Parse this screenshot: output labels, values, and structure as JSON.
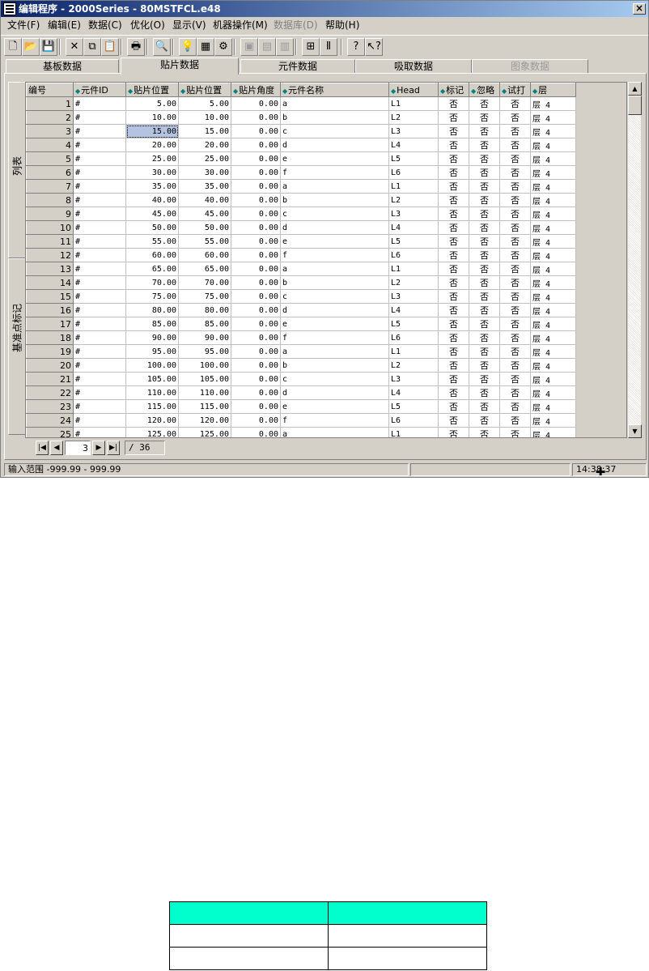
{
  "window": {
    "title": "编辑程序 - 2000Series - 80MSTFCL.e48",
    "close_label": "×"
  },
  "menu": [
    {
      "label": "文件(F)",
      "disabled": false
    },
    {
      "label": "编辑(E)",
      "disabled": false
    },
    {
      "label": "数据(C)",
      "disabled": false
    },
    {
      "label": "优化(O)",
      "disabled": false
    },
    {
      "label": "显示(V)",
      "disabled": false
    },
    {
      "label": "机器操作(M)",
      "disabled": false
    },
    {
      "label": "数据库(D)",
      "disabled": true
    },
    {
      "label": "帮助(H)",
      "disabled": false
    }
  ],
  "toolbar": {
    "buttons": [
      {
        "icon": "new-file-icon",
        "glyph": "🗋"
      },
      {
        "icon": "open-folder-icon",
        "glyph": "📂"
      },
      {
        "icon": "save-icon",
        "glyph": "💾"
      },
      {
        "icon": "cut-icon",
        "glyph": "✕"
      },
      {
        "icon": "copy-icon",
        "glyph": "⧉"
      },
      {
        "icon": "paste-icon",
        "glyph": "📋"
      },
      {
        "icon": "print-icon",
        "glyph": "🖶"
      },
      {
        "icon": "find-icon",
        "glyph": "🔍"
      },
      {
        "icon": "bulb-icon",
        "glyph": "💡"
      },
      {
        "icon": "component-icon",
        "glyph": "▦"
      },
      {
        "icon": "optimize-icon",
        "glyph": "⚙"
      },
      {
        "icon": "machine-icon",
        "glyph": "▣"
      },
      {
        "icon": "feeder-icon",
        "glyph": "▤"
      },
      {
        "icon": "box-icon",
        "glyph": "▥"
      },
      {
        "icon": "fit-icon",
        "glyph": "⊞"
      },
      {
        "icon": "align-icon",
        "glyph": "Ⅱ"
      },
      {
        "icon": "help-icon",
        "glyph": "?"
      },
      {
        "icon": "context-help-icon",
        "glyph": "↖?"
      }
    ]
  },
  "tabs": [
    {
      "label": "基板数据",
      "active": false,
      "disabled": false
    },
    {
      "label": "贴片数据",
      "active": true,
      "disabled": false
    },
    {
      "label": "元件数据",
      "active": false,
      "disabled": false
    },
    {
      "label": "吸取数据",
      "active": false,
      "disabled": false
    },
    {
      "label": "图象数据",
      "active": false,
      "disabled": true
    }
  ],
  "side_tabs": [
    {
      "label": "列表"
    },
    {
      "label": "基准点标记"
    }
  ],
  "grid": {
    "columns": [
      "编号",
      "元件ID",
      "贴片位置",
      "贴片位置",
      "贴片角度",
      "元件名称",
      "Head",
      "标记",
      "忽略",
      "试打",
      "层"
    ],
    "sortable": [
      false,
      true,
      true,
      true,
      true,
      true,
      true,
      true,
      true,
      true,
      true
    ],
    "rows": [
      [
        "1",
        "#",
        "5.00",
        "5.00",
        "0.00",
        "a",
        "L1",
        "否",
        "否",
        "否",
        "层 4"
      ],
      [
        "2",
        "#",
        "10.00",
        "10.00",
        "0.00",
        "b",
        "L2",
        "否",
        "否",
        "否",
        "层 4"
      ],
      [
        "3",
        "#",
        "15.00",
        "15.00",
        "0.00",
        "c",
        "L3",
        "否",
        "否",
        "否",
        "层 4"
      ],
      [
        "4",
        "#",
        "20.00",
        "20.00",
        "0.00",
        "d",
        "L4",
        "否",
        "否",
        "否",
        "层 4"
      ],
      [
        "5",
        "#",
        "25.00",
        "25.00",
        "0.00",
        "e",
        "L5",
        "否",
        "否",
        "否",
        "层 4"
      ],
      [
        "6",
        "#",
        "30.00",
        "30.00",
        "0.00",
        "f",
        "L6",
        "否",
        "否",
        "否",
        "层 4"
      ],
      [
        "7",
        "#",
        "35.00",
        "35.00",
        "0.00",
        "a",
        "L1",
        "否",
        "否",
        "否",
        "层 4"
      ],
      [
        "8",
        "#",
        "40.00",
        "40.00",
        "0.00",
        "b",
        "L2",
        "否",
        "否",
        "否",
        "层 4"
      ],
      [
        "9",
        "#",
        "45.00",
        "45.00",
        "0.00",
        "c",
        "L3",
        "否",
        "否",
        "否",
        "层 4"
      ],
      [
        "10",
        "#",
        "50.00",
        "50.00",
        "0.00",
        "d",
        "L4",
        "否",
        "否",
        "否",
        "层 4"
      ],
      [
        "11",
        "#",
        "55.00",
        "55.00",
        "0.00",
        "e",
        "L5",
        "否",
        "否",
        "否",
        "层 4"
      ],
      [
        "12",
        "#",
        "60.00",
        "60.00",
        "0.00",
        "f",
        "L6",
        "否",
        "否",
        "否",
        "层 4"
      ],
      [
        "13",
        "#",
        "65.00",
        "65.00",
        "0.00",
        "a",
        "L1",
        "否",
        "否",
        "否",
        "层 4"
      ],
      [
        "14",
        "#",
        "70.00",
        "70.00",
        "0.00",
        "b",
        "L2",
        "否",
        "否",
        "否",
        "层 4"
      ],
      [
        "15",
        "#",
        "75.00",
        "75.00",
        "0.00",
        "c",
        "L3",
        "否",
        "否",
        "否",
        "层 4"
      ],
      [
        "16",
        "#",
        "80.00",
        "80.00",
        "0.00",
        "d",
        "L4",
        "否",
        "否",
        "否",
        "层 4"
      ],
      [
        "17",
        "#",
        "85.00",
        "85.00",
        "0.00",
        "e",
        "L5",
        "否",
        "否",
        "否",
        "层 4"
      ],
      [
        "18",
        "#",
        "90.00",
        "90.00",
        "0.00",
        "f",
        "L6",
        "否",
        "否",
        "否",
        "层 4"
      ],
      [
        "19",
        "#",
        "95.00",
        "95.00",
        "0.00",
        "a",
        "L1",
        "否",
        "否",
        "否",
        "层 4"
      ],
      [
        "20",
        "#",
        "100.00",
        "100.00",
        "0.00",
        "b",
        "L2",
        "否",
        "否",
        "否",
        "层 4"
      ],
      [
        "21",
        "#",
        "105.00",
        "105.00",
        "0.00",
        "c",
        "L3",
        "否",
        "否",
        "否",
        "层 4"
      ],
      [
        "22",
        "#",
        "110.00",
        "110.00",
        "0.00",
        "d",
        "L4",
        "否",
        "否",
        "否",
        "层 4"
      ],
      [
        "23",
        "#",
        "115.00",
        "115.00",
        "0.00",
        "e",
        "L5",
        "否",
        "否",
        "否",
        "层 4"
      ],
      [
        "24",
        "#",
        "120.00",
        "120.00",
        "0.00",
        "f",
        "L6",
        "否",
        "否",
        "否",
        "层 4"
      ],
      [
        "25",
        "#",
        "125.00",
        "125.00",
        "0.00",
        "a",
        "L1",
        "否",
        "否",
        "否",
        "层 4"
      ]
    ],
    "selected_cell": {
      "row": 2,
      "col": 2
    }
  },
  "pager": {
    "page": "3",
    "total": "/ 36"
  },
  "status": {
    "hint": "输入范围  -999.99 - 999.99",
    "middle": "",
    "right": "",
    "time": "14:38:37"
  },
  "lower_table": {
    "header_color": "#00ffcc"
  }
}
